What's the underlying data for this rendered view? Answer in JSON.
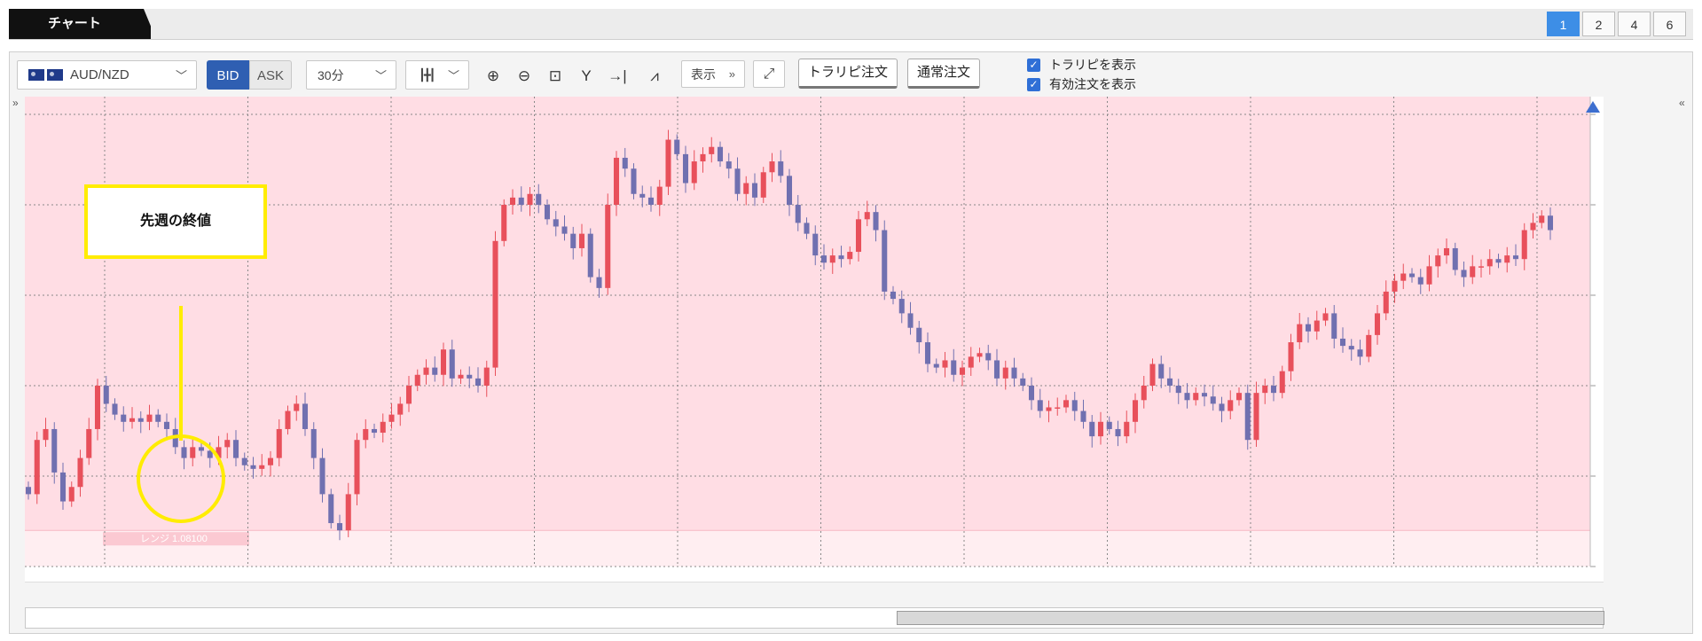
{
  "app": {
    "title": "チャート"
  },
  "layout_buttons": [
    "1",
    "2",
    "4",
    "6"
  ],
  "toolbar": {
    "pair": "AUD/NZD",
    "bid": "BID",
    "ask": "ASK",
    "timeframe": "30分",
    "display": "表示",
    "trail_order": "トラリピ注文",
    "normal_order": "通常注文",
    "checkbox_trail": "トラリピを表示",
    "checkbox_active": "有効注文を表示"
  },
  "icons": [
    "candlestick-icon",
    "zoom-in-icon",
    "zoom-out-icon",
    "fit-icon",
    "y-lock-icon",
    "jump-latest-icon",
    "indicator-icon",
    "fullscreen-icon"
  ],
  "annotation": {
    "callout": "先週の終値",
    "range_label": "レンジ 1.08100"
  },
  "colors": {
    "up": "#e8505b",
    "down": "#7070b0",
    "background": "#ffdde4",
    "accent": "#3d8ee6",
    "highlight": "#ffec00"
  },
  "chart_data": {
    "type": "candlestick",
    "ylim": [
      1.08,
      1.0925
    ],
    "yticks": [
      "1.09250",
      "1.09000",
      "1.08750",
      "1.08500",
      "1.08250",
      "1.08000"
    ],
    "xticks": [
      "04/02 00:00",
      "04/04 13:30",
      "04/05 02:00",
      "14:30",
      "04/06 03:00",
      "15:30",
      "04/07 04:00",
      "16:30",
      "04/08 05:00",
      "17:30",
      "04/09 06:00"
    ],
    "range_line": 1.081,
    "closes": [
      1.082,
      1.0835,
      1.0838,
      1.0826,
      1.0818,
      1.0822,
      1.083,
      1.0838,
      1.085,
      1.0845,
      1.0842,
      1.084,
      1.0841,
      1.084,
      1.0842,
      1.084,
      1.0838,
      1.0833,
      1.083,
      1.0833,
      1.0832,
      1.083,
      1.0833,
      1.0835,
      1.083,
      1.0828,
      1.0827,
      1.0828,
      1.083,
      1.0838,
      1.0843,
      1.0845,
      1.0838,
      1.083,
      1.082,
      1.0812,
      1.081,
      1.082,
      1.0835,
      1.0838,
      1.0837,
      1.084,
      1.0842,
      1.0845,
      1.085,
      1.0853,
      1.0855,
      1.0853,
      1.086,
      1.0852,
      1.0853,
      1.0852,
      1.085,
      1.0855,
      1.089,
      1.09,
      1.0902,
      1.09,
      1.0903,
      1.09,
      1.0896,
      1.0894,
      1.0892,
      1.0888,
      1.0892,
      1.088,
      1.0877,
      1.09,
      1.0913,
      1.091,
      1.0903,
      1.0902,
      1.09,
      1.0905,
      1.0918,
      1.0914,
      1.0906,
      1.0912,
      1.0914,
      1.0916,
      1.0912,
      1.091,
      1.0903,
      1.0906,
      1.0902,
      1.0909,
      1.0912,
      1.0908,
      1.09,
      1.0895,
      1.0892,
      1.0886,
      1.0884,
      1.0886,
      1.0885,
      1.0887,
      1.0896,
      1.0898,
      1.0893,
      1.0876,
      1.0874,
      1.087,
      1.0866,
      1.0862,
      1.0856,
      1.0855,
      1.0857,
      1.0853,
      1.0855,
      1.0858,
      1.0859,
      1.0857,
      1.0852,
      1.0855,
      1.0852,
      1.085,
      1.0846,
      1.0843,
      1.0844,
      1.0844,
      1.0846,
      1.0843,
      1.084,
      1.0836,
      1.084,
      1.0838,
      1.0836,
      1.084,
      1.0846,
      1.085,
      1.0856,
      1.0852,
      1.085,
      1.0848,
      1.0846,
      1.0848,
      1.0847,
      1.0845,
      1.0843,
      1.0846,
      1.0848,
      1.0835,
      1.0848,
      1.085,
      1.0848,
      1.0854,
      1.0862,
      1.0867,
      1.0865,
      1.0868,
      1.087,
      1.0863,
      1.0861,
      1.086,
      1.0858,
      1.0864,
      1.087,
      1.0876,
      1.0879,
      1.0881,
      1.088,
      1.0878,
      1.0883,
      1.0886,
      1.0888,
      1.0882,
      1.088,
      1.0883,
      1.0883,
      1.0885,
      1.0884,
      1.0886,
      1.0885,
      1.0893,
      1.0895,
      1.0897,
      1.0893
    ]
  }
}
